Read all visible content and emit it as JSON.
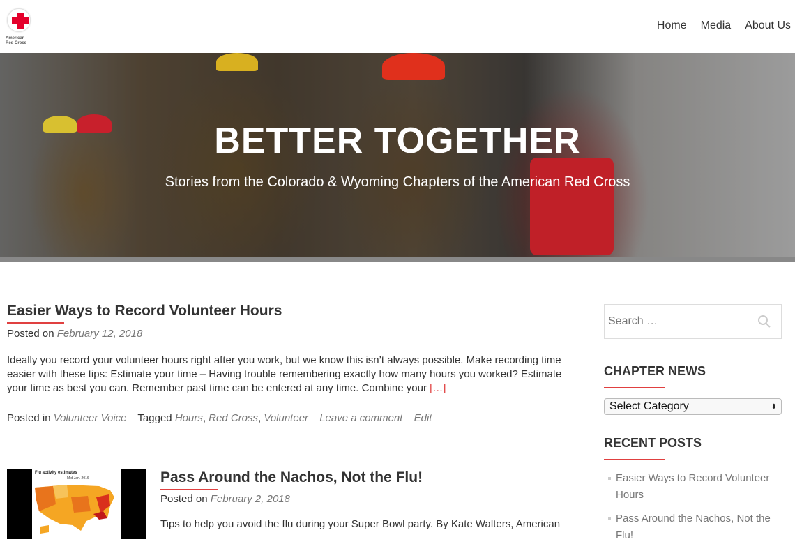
{
  "header": {
    "logo_text": "American Red Cross",
    "nav": [
      "Home",
      "Media",
      "About Us"
    ]
  },
  "hero": {
    "title": "BETTER TOGETHER",
    "subtitle": "Stories from the Colorado & Wyoming Chapters of the American Red Cross"
  },
  "posts": [
    {
      "title": "Easier Ways to Record Volunteer Hours",
      "posted_on_label": "Posted on",
      "date": "February 12, 2018",
      "excerpt": "Ideally you record your volunteer hours right after you work, but we know this isn’t always possible.  Make recording time easier with these tips: Estimate your time – Having trouble remembering exactly how many hours you worked? Estimate your time as best you can. Remember past time can be entered at any time. Combine your",
      "more": "[…]",
      "posted_in_label": "Posted in",
      "category": "Volunteer Voice",
      "tagged_label": "Tagged",
      "tags": [
        "Hours",
        "Red Cross",
        "Volunteer"
      ],
      "comment": "Leave a comment",
      "edit": "Edit"
    },
    {
      "title": "Pass Around the Nachos, Not the Flu!",
      "posted_on_label": "Posted on",
      "date": "February 2, 2018",
      "excerpt": "Tips to help you avoid the flu during your Super Bowl party. By Kate Walters, American",
      "thumb_caption": "Flu activity estimates",
      "thumb_sub": "Mid-Jan. 2016"
    }
  ],
  "sidebar": {
    "search_placeholder": "Search …",
    "chapter_news_title": "CHAPTER NEWS",
    "category_select": "Select Category",
    "recent_posts_title": "RECENT POSTS",
    "recent_posts": [
      "Easier Ways to Record Volunteer Hours",
      "Pass Around the Nachos, Not the Flu!"
    ]
  },
  "colors": {
    "accent": "#e04040",
    "brand_red": "#e4002b",
    "link_gray": "#777777"
  }
}
